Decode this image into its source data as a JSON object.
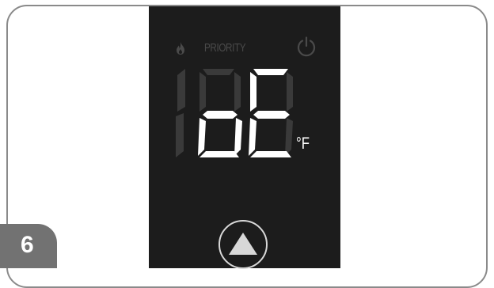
{
  "panel": {
    "indicator_label": "PRIORITY",
    "display_text": "bE",
    "unit": "°F",
    "icons": {
      "flame": "flame-icon",
      "power": "power-icon",
      "up": "up-arrow-icon"
    }
  },
  "step": {
    "number": "6"
  },
  "colors": {
    "panel_bg": "#1c1c1c",
    "segment_on": "#ffffff",
    "segment_off": "#3a3a3a",
    "badge": "#727272"
  }
}
